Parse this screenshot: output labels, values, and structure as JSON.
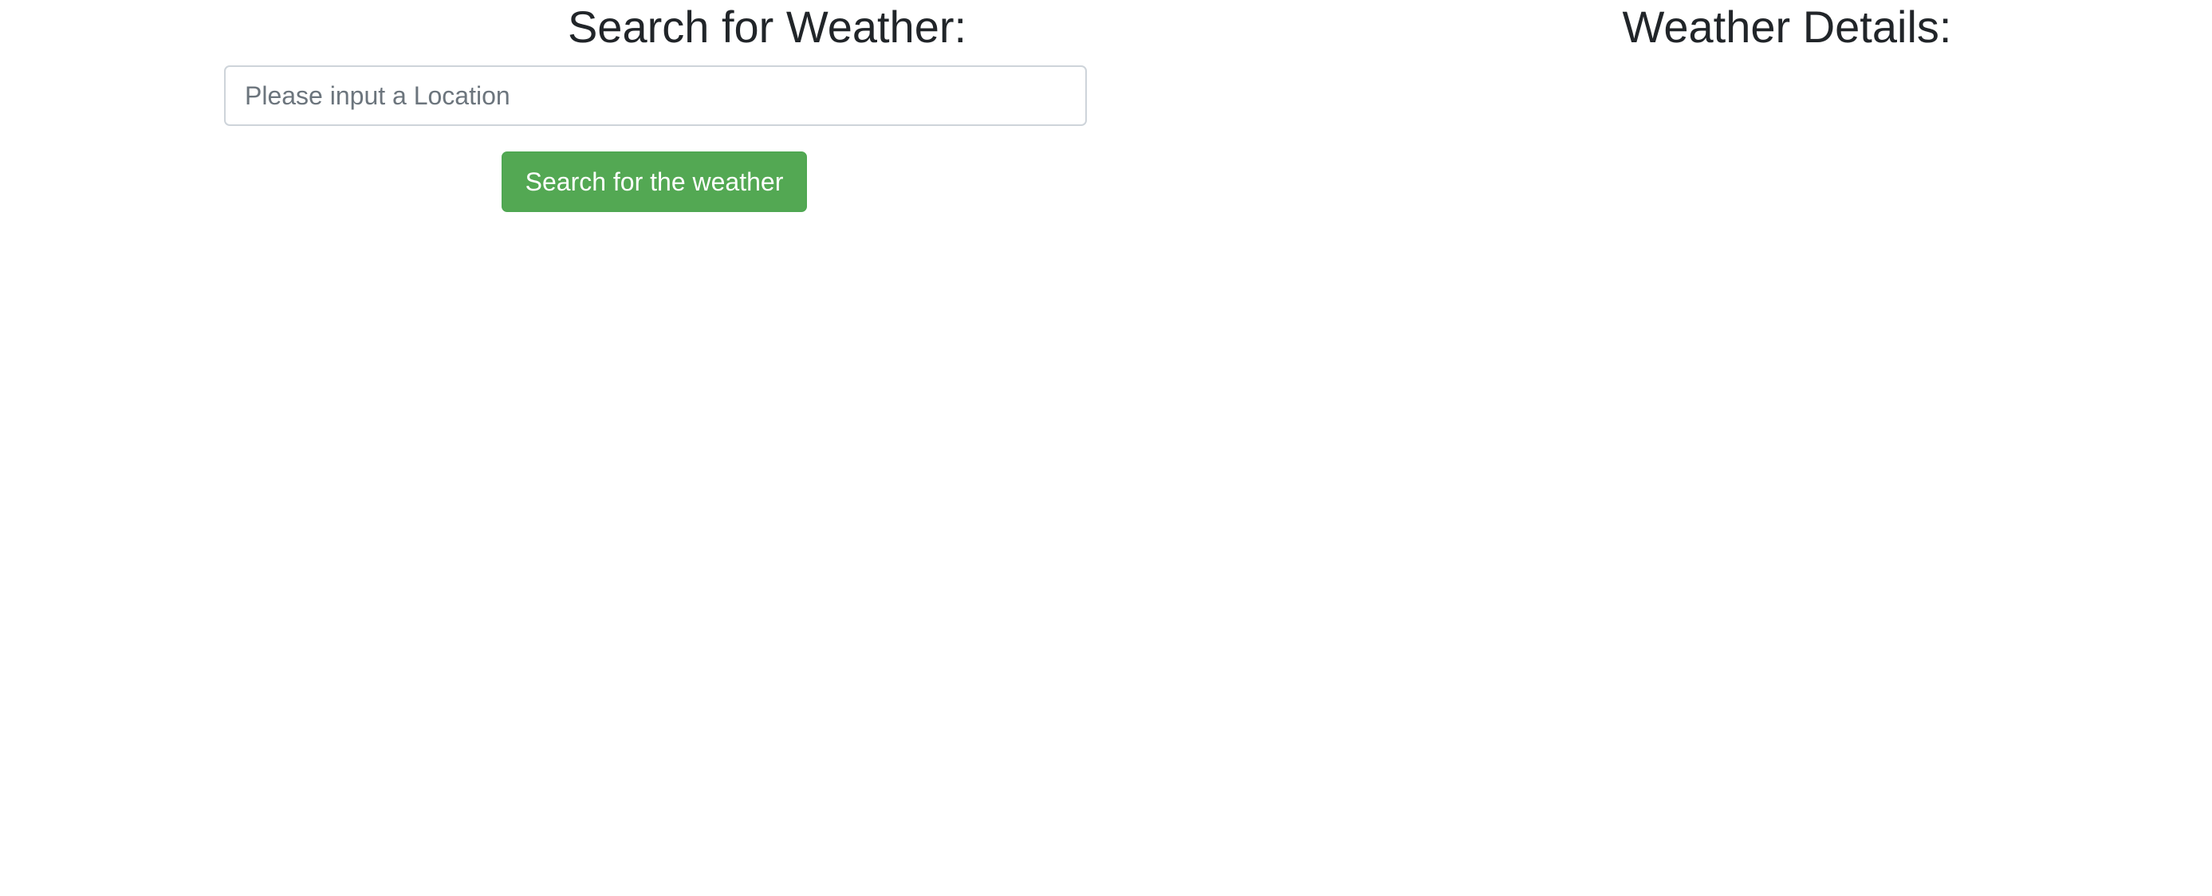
{
  "search_section": {
    "title": "Search for Weather:",
    "location_input": {
      "value": "",
      "placeholder": "Please input a Location"
    },
    "search_button_label": "Search for the weather"
  },
  "details_section": {
    "title": "Weather Details:"
  },
  "colors": {
    "button_background": "#53a853",
    "button_text": "#ffffff",
    "heading_text": "#212529",
    "input_border": "#ced4da",
    "placeholder_text": "#6c757d"
  }
}
